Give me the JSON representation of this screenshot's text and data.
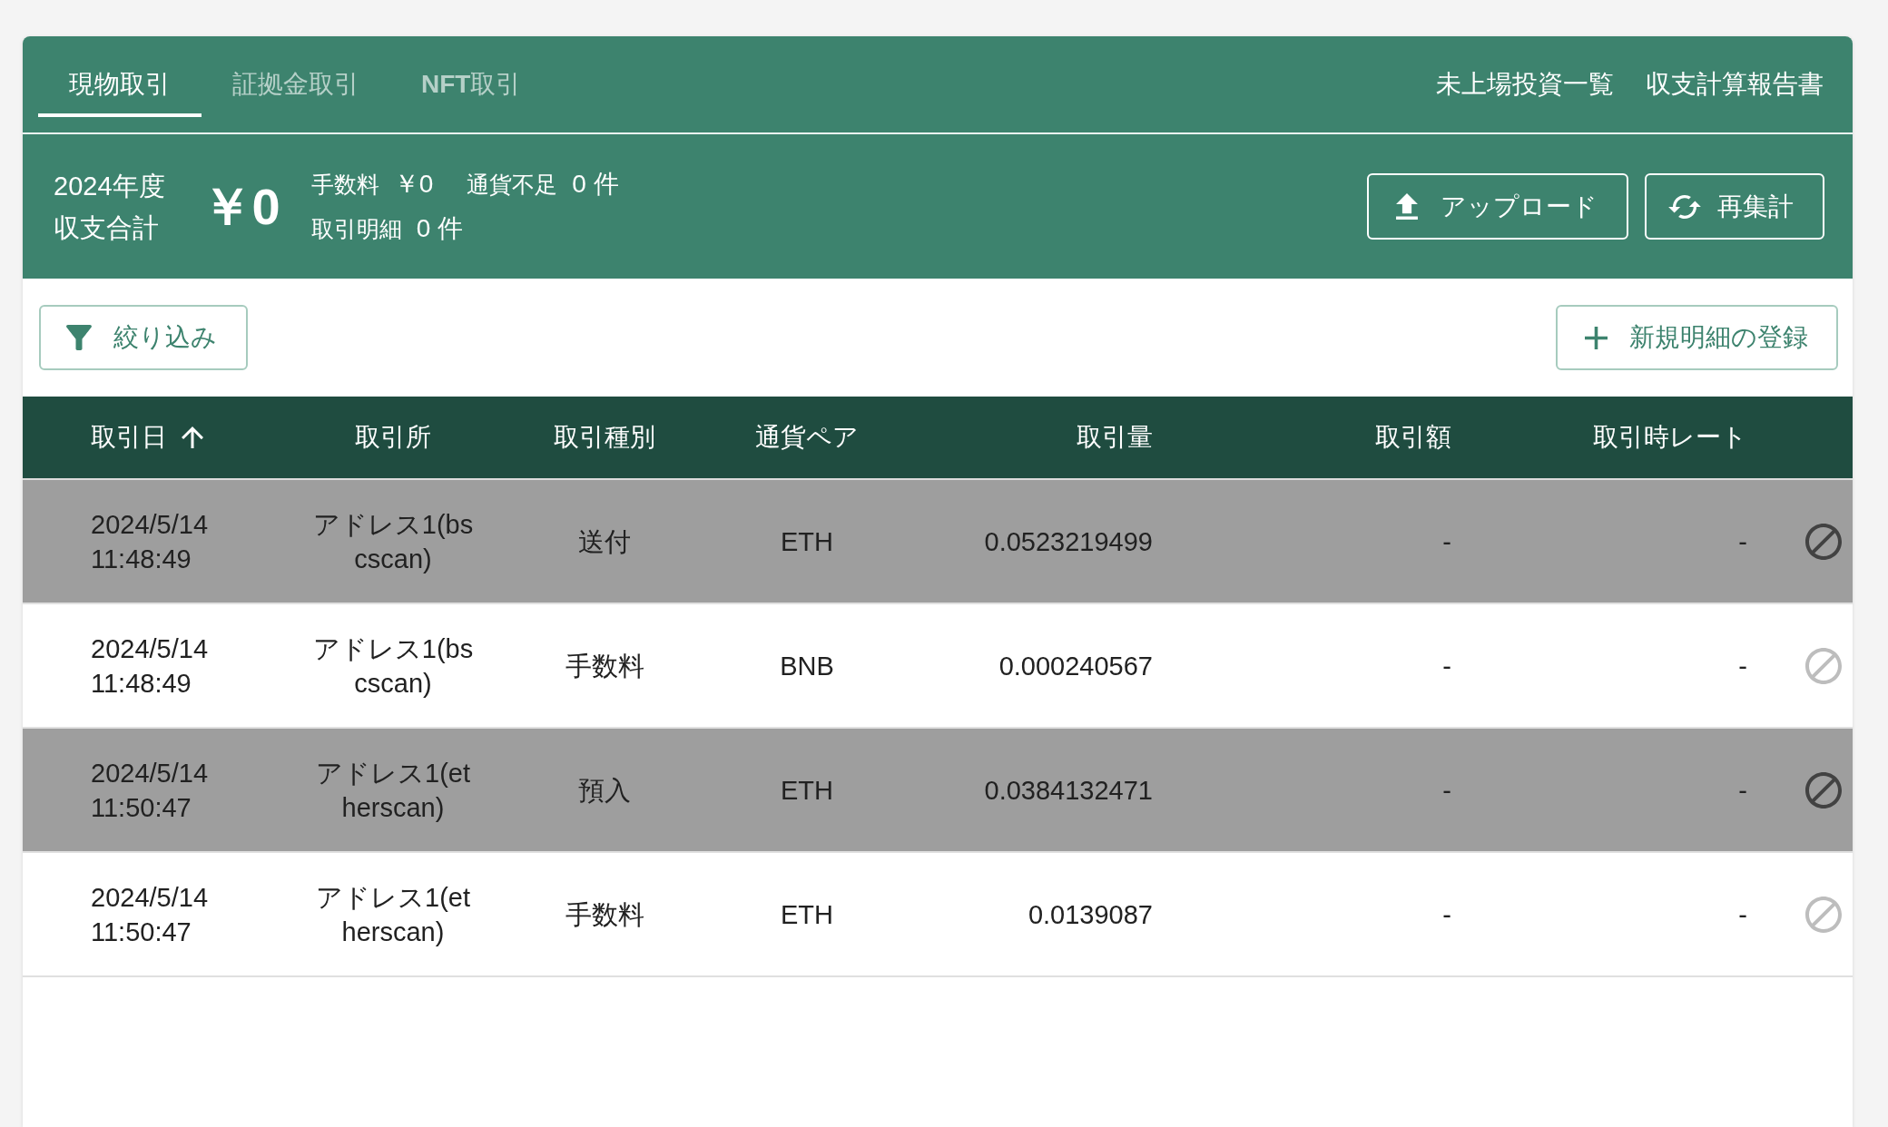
{
  "tabs": [
    {
      "label": "現物取引",
      "selected": true
    },
    {
      "label": "証拠金取引",
      "selected": false
    },
    {
      "label": "**NFT**取引",
      "selected": false
    }
  ],
  "header_links": [
    "未上場投資一覧",
    "収支計算報告書"
  ],
  "summary": {
    "period": "2024年度",
    "label": "収支合計",
    "total": "￥0",
    "stats": [
      {
        "label": "手数料",
        "value": "￥0"
      },
      {
        "label": "通貨不足",
        "value": "0 件"
      },
      {
        "label": "取引明細",
        "value": "0 件"
      }
    ]
  },
  "actions": [
    {
      "kind": "upload",
      "label": "アップロード"
    },
    {
      "kind": "recalculate",
      "label": "再集計"
    }
  ],
  "filter_button": "絞り込み",
  "add_button": "新規明細の登録",
  "table": {
    "columns": [
      {
        "label": "取引日",
        "sorted": true
      },
      {
        "label": "取引所"
      },
      {
        "label": "取引種別"
      },
      {
        "label": "通貨ペア"
      },
      {
        "label": "取引量"
      },
      {
        "label": "取引額"
      },
      {
        "label": "取引時レート"
      }
    ],
    "rows": [
      {
        "date": "2024/5/14 11:48:49",
        "exchange": "アドレス1(bscscan)",
        "type": "送付",
        "pair": "ETH",
        "amount": "0.0523219499",
        "value": "-",
        "rate": "-",
        "excluded": true
      },
      {
        "date": "2024/5/14 11:48:49",
        "exchange": "アドレス1(bscscan)",
        "type": "手数料",
        "pair": "BNB",
        "amount": "0.000240567",
        "value": "-",
        "rate": "-",
        "excluded": false
      },
      {
        "date": "2024/5/14 11:50:47",
        "exchange": "アドレス1(etherscan)",
        "type": "預入",
        "pair": "ETH",
        "amount": "0.0384132471",
        "value": "-",
        "rate": "-",
        "excluded": true
      },
      {
        "date": "2024/5/14 11:50:47",
        "exchange": "アドレス1(etherscan)",
        "type": "手数料",
        "pair": "ETH",
        "amount": "0.0139087",
        "value": "-",
        "rate": "-",
        "excluded": false
      }
    ]
  }
}
